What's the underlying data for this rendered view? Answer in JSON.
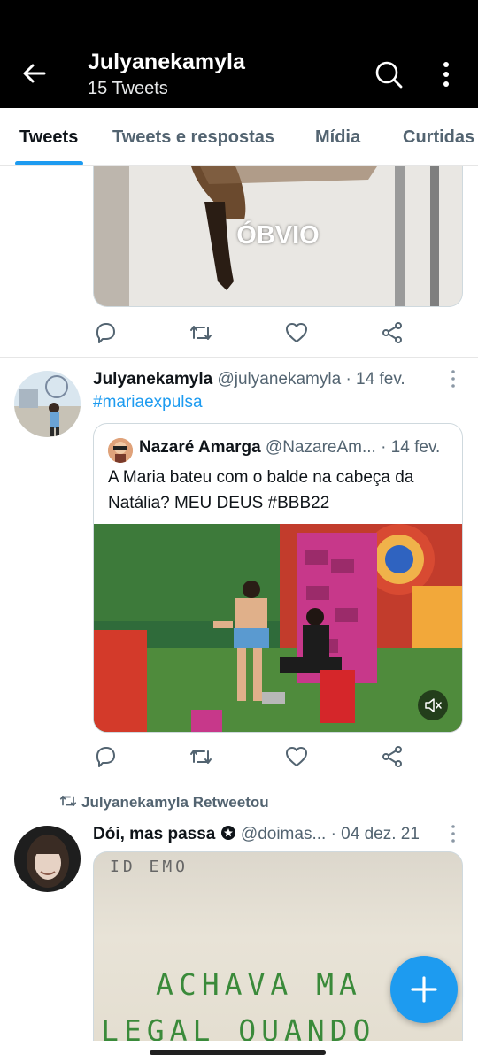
{
  "header": {
    "title": "Julyanekamyla",
    "subtitle": "15 Tweets",
    "back_icon": "arrow-left-icon",
    "search_icon": "search-icon",
    "more_icon": "more-vertical-icon"
  },
  "tabs": [
    {
      "label": "Tweets",
      "active": true
    },
    {
      "label": "Tweets e respostas",
      "active": false
    },
    {
      "label": "Mídia",
      "active": false
    },
    {
      "label": "Curtidas",
      "active": false
    }
  ],
  "tweet1": {
    "image_caption": "ÓBVIO"
  },
  "tweet2": {
    "author": "Julyanekamyla",
    "handle": "@julyanekamyla",
    "date": "· 14 fev.",
    "text": "#mariaexpulsa",
    "quote": {
      "author": "Nazaré Amarga",
      "handle": "@NazareAm...",
      "date": "· 14 fev.",
      "text": "A Maria bateu com o balde na cabeça da Natália? MEU DEUS #BBB22"
    }
  },
  "tweet3": {
    "retweet_label": "Julyanekamyla Retweetou",
    "author": "Dói, mas passa",
    "handle": "@doimas...",
    "date": "· 04 dez. 21",
    "image_text_top": "ID EMO",
    "image_text_line1": "ACHAVA MA",
    "image_text_line2": "LEGAL QUANDO"
  },
  "colors": {
    "accent": "#1d9bf0",
    "header_bg": "#000000",
    "muted_text": "#536471"
  },
  "fab_icon": "plus-icon"
}
